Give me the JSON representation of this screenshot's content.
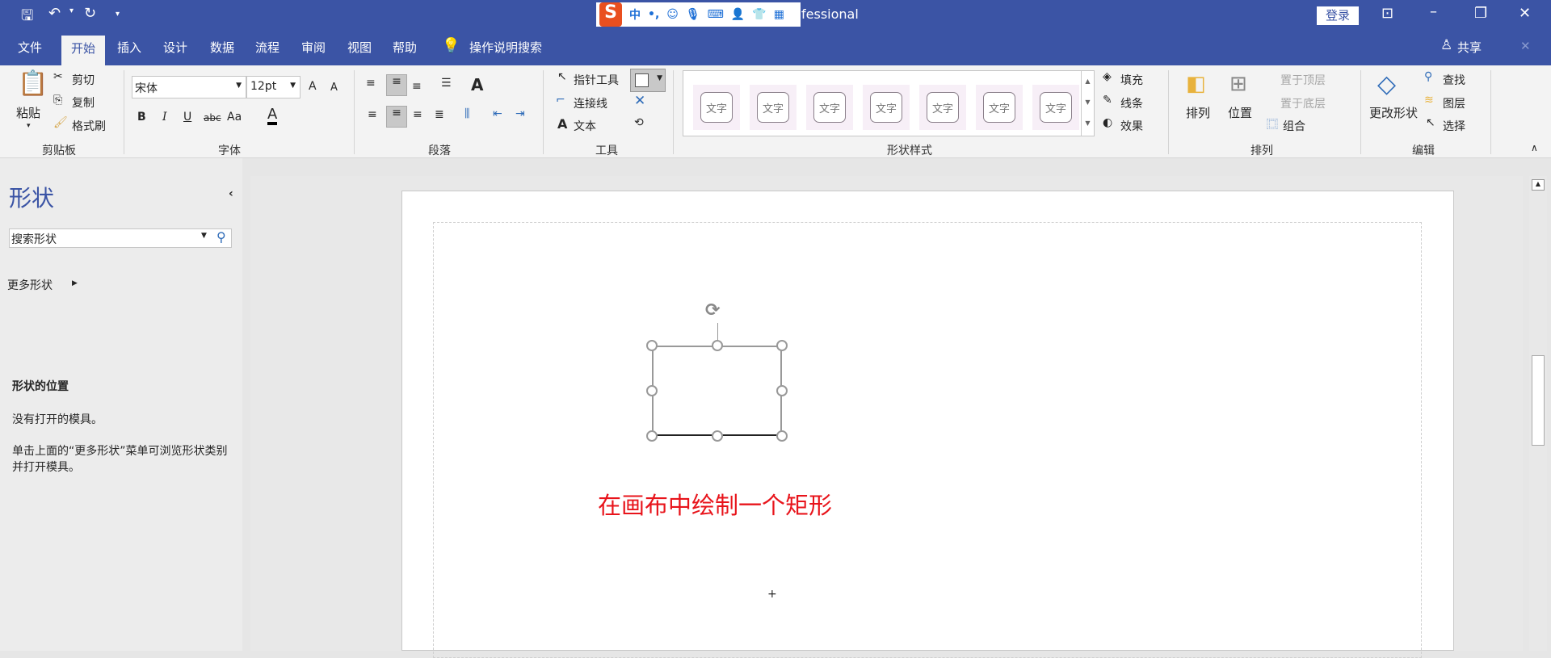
{
  "titlebar": {
    "title_fragment": "fessional",
    "login": "登录",
    "ime": {
      "logo": "S",
      "mode": "中",
      "punct": "•,"
    }
  },
  "tabs": [
    "文件",
    "开始",
    "插入",
    "设计",
    "数据",
    "流程",
    "审阅",
    "视图",
    "帮助"
  ],
  "tell_me": "操作说明搜索",
  "share": "共享",
  "clipboard": {
    "paste": "粘贴",
    "cut": "剪切",
    "copy": "复制",
    "format_painter": "格式刷",
    "label": "剪贴板"
  },
  "font": {
    "name": "宋体",
    "size": "12pt",
    "label": "字体",
    "bold": "B",
    "italic": "I",
    "underline": "U",
    "strike": "abc",
    "case": "Aa",
    "color": "A",
    "grow": "A",
    "shrink": "A"
  },
  "paragraph": {
    "label": "段落"
  },
  "tools": {
    "pointer": "指针工具",
    "connector": "连接线",
    "text": "文本",
    "label": "工具"
  },
  "shape_styles": {
    "items": [
      "文字",
      "文字",
      "文字",
      "文字",
      "文字",
      "文字",
      "文字"
    ],
    "fill": "填充",
    "line": "线条",
    "effect": "效果",
    "label": "形状样式"
  },
  "arrange": {
    "arrange": "排列",
    "position": "位置",
    "bring_front": "置于顶层",
    "send_back": "置于底层",
    "group": "组合",
    "label": "排列"
  },
  "editing": {
    "change_shape": "更改形状",
    "find": "查找",
    "layers": "图层",
    "select": "选择",
    "label": "编辑"
  },
  "shapes_pane": {
    "title": "形状",
    "search_placeholder": "搜索形状",
    "more_shapes": "更多形状",
    "location_heading": "形状的位置",
    "no_stencils": "没有打开的模具。",
    "hint": "单击上面的“更多形状”菜单可浏览形状类别并打开模具。"
  },
  "canvas": {
    "annotation": "在画布中绘制一个矩形",
    "annotation_color": "#e8141b"
  }
}
